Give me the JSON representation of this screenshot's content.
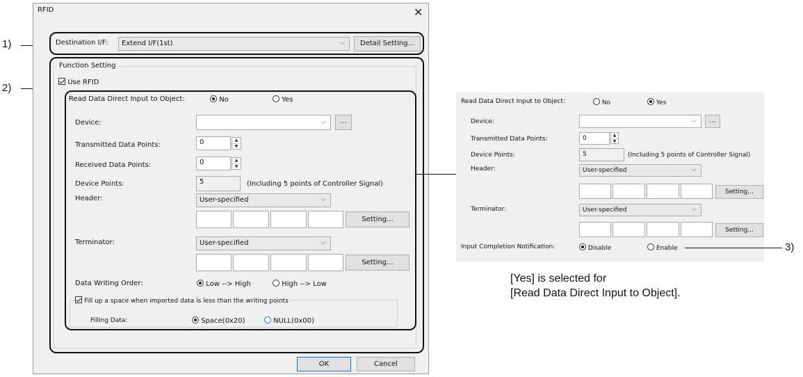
{
  "window": {
    "title": "RFID"
  },
  "markers": {
    "m1": "1)",
    "m2": "2)",
    "m3": "3)"
  },
  "destination": {
    "label": "Destination I/F:",
    "value": "Extend I/F(1st)",
    "detail_button": "Detail Setting..."
  },
  "function_setting": {
    "title": "Function Setting",
    "use_rfid": "Use RFID"
  },
  "direct_input": {
    "label": "Read Data Direct Input to Object:",
    "options": [
      "No",
      "Yes"
    ]
  },
  "device": {
    "label": "Device:",
    "browse": "..."
  },
  "transmitted": {
    "label": "Transmitted Data Points:",
    "value": "0"
  },
  "received": {
    "label": "Received Data Points:",
    "value": "0"
  },
  "device_points": {
    "label": "Device Points:",
    "value": "5",
    "note": "(Including 5 points of Controller Signal)"
  },
  "header": {
    "label": "Header:",
    "value": "User-specified",
    "setting": "Setting..."
  },
  "terminator": {
    "label": "Terminator:",
    "value": "User-specified",
    "setting": "Setting..."
  },
  "writing_order": {
    "label": "Data Writing Order:",
    "options": [
      "Low --> High",
      "High --> Low"
    ]
  },
  "fill": {
    "checkbox": "Fill up a space when imported data is less than the writing points",
    "label": "Filling Data:",
    "options": [
      "Space(0x20)",
      "NULL(0x00)"
    ]
  },
  "footer": {
    "ok": "OK",
    "cancel": "Cancel"
  },
  "panel": {
    "direct_label": "Read Data Direct Input to Object:",
    "direct_options": [
      "No",
      "Yes"
    ],
    "device_label": "Device:",
    "browse": "...",
    "transmitted_label": "Transmitted Data Points:",
    "transmitted_value": "0",
    "device_points_label": "Device Points:",
    "device_points_value": "5",
    "device_points_note": "(Including 5 points of Controller Signal)",
    "header_label": "Header:",
    "header_value": "User-specified",
    "terminator_label": "Terminator:",
    "terminator_value": "User-specified",
    "setting": "Setting...",
    "notify_label": "Input Completion Notification:",
    "notify_options": [
      "Disable",
      "Enable"
    ]
  },
  "caption": {
    "line1": "[Yes] is selected for",
    "line2": "[Read Data Direct Input to Object]."
  }
}
